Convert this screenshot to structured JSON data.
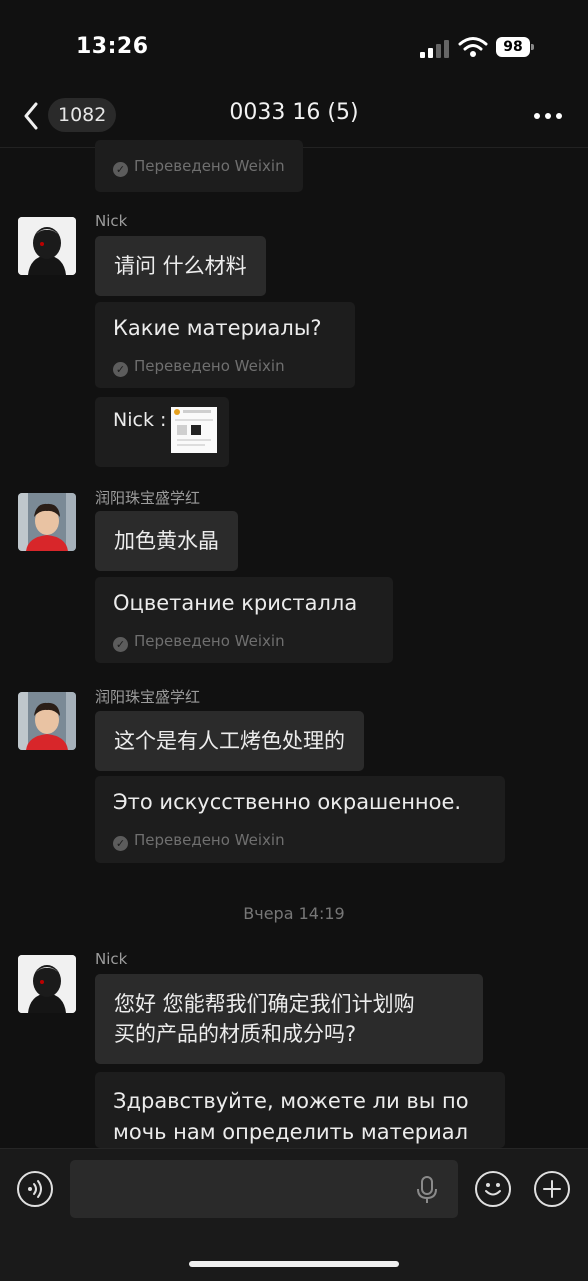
{
  "status_bar": {
    "time": "13:26",
    "battery": "98"
  },
  "nav": {
    "unread_count": "1082",
    "title": "0033 16 (5)"
  },
  "translated_note": "Переведено Weixin",
  "messages": [
    {
      "sender": "Nick",
      "text": "请问 什么材料",
      "translation": "Какие материалы?"
    },
    {
      "sender": "Nick",
      "quote_label": "Nick :"
    },
    {
      "sender": "润阳珠宝盛学红",
      "text": "加色黄水晶",
      "translation": "Оцветание кристалла"
    },
    {
      "sender": "润阳珠宝盛学红",
      "text": "这个是有人工烤色处理的",
      "translation": "Это искусственно окрашенное."
    },
    {
      "sender": "Nick",
      "text_line1": "您好 您能帮我们确定我们计划购",
      "text_line2": "买的产品的材质和成分吗?",
      "translation_line1": "Здравствуйте, можете ли вы по",
      "translation_line2": "мочь нам определить материал"
    }
  ],
  "timestamp": "Вчера 14:19",
  "input": {
    "placeholder": ""
  },
  "icons": [
    "back-chevron-icon",
    "more-dots-icon",
    "voice-icon",
    "microphone-icon",
    "emoji-icon",
    "plus-icon",
    "check-icon"
  ]
}
